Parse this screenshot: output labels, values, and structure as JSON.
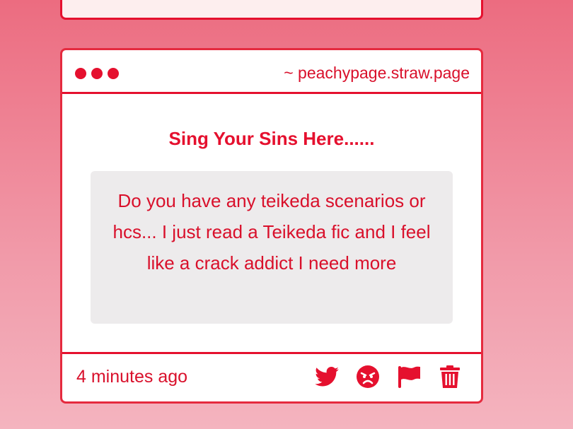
{
  "colors": {
    "accent": "#e5102e",
    "text": "#d9102b",
    "card_bg": "#ffffff",
    "message_bg": "#edebec",
    "page_bg_top": "#ec6c80",
    "page_bg_bottom": "#f4b4bf"
  },
  "card": {
    "url": "~ peachypage.straw.page",
    "title": "Sing Your Sins Here......",
    "message": "Do you have any teikeda scenarios or hcs... I just read a Teikeda fic and I feel like a crack addict I need more",
    "timestamp": "4 minutes ago",
    "actions": [
      {
        "icon": "twitter-icon"
      },
      {
        "icon": "angry-face-icon"
      },
      {
        "icon": "flag-icon"
      },
      {
        "icon": "trash-icon"
      }
    ]
  }
}
